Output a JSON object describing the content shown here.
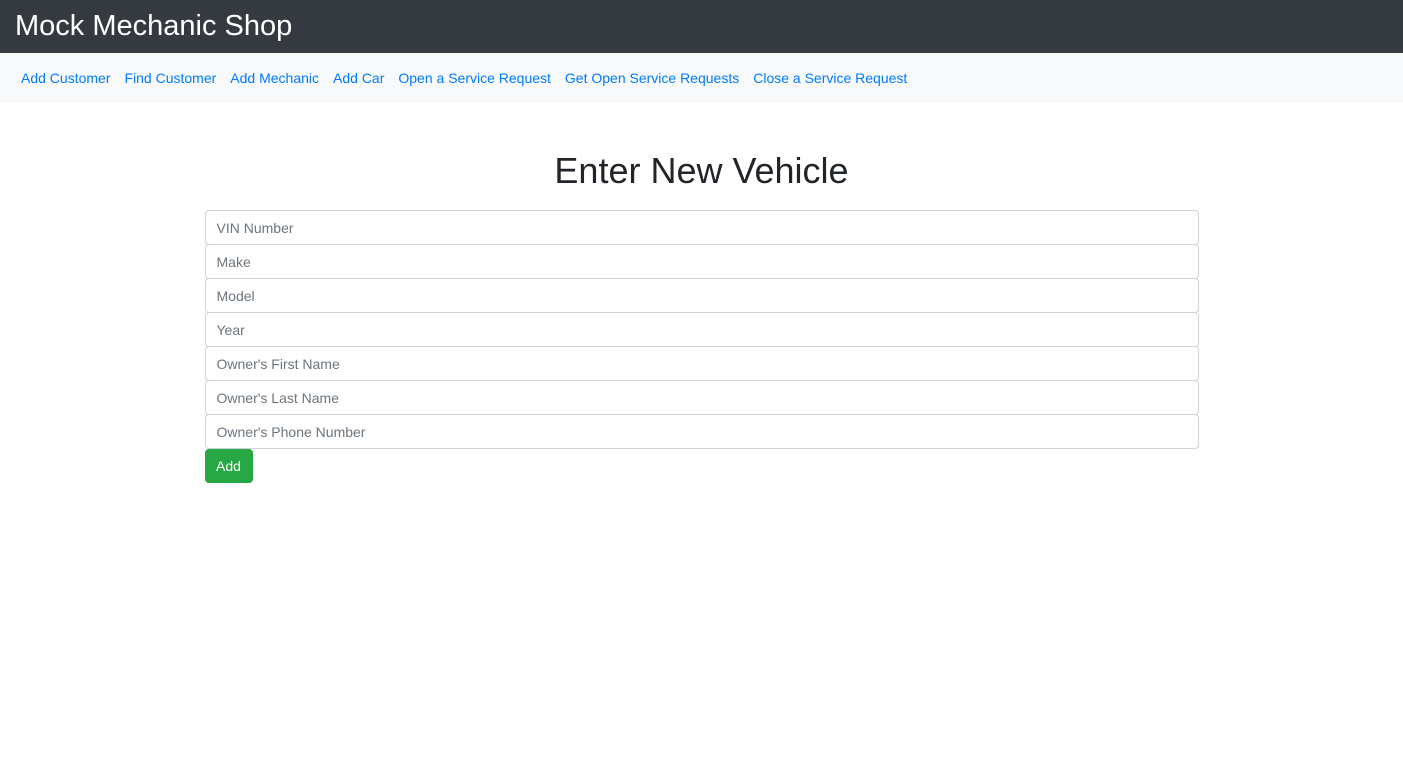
{
  "header": {
    "title": "Mock Mechanic Shop"
  },
  "nav": {
    "items": [
      {
        "label": "Add Customer"
      },
      {
        "label": "Find Customer"
      },
      {
        "label": "Add Mechanic"
      },
      {
        "label": "Add Car"
      },
      {
        "label": "Open a Service Request"
      },
      {
        "label": "Get Open Service Requests"
      },
      {
        "label": "Close a Service Request"
      }
    ]
  },
  "form": {
    "title": "Enter New Vehicle",
    "fields": {
      "vin": {
        "placeholder": "VIN Number",
        "value": ""
      },
      "make": {
        "placeholder": "Make",
        "value": ""
      },
      "model": {
        "placeholder": "Model",
        "value": ""
      },
      "year": {
        "placeholder": "Year",
        "value": ""
      },
      "first_name": {
        "placeholder": "Owner's First Name",
        "value": ""
      },
      "last_name": {
        "placeholder": "Owner's Last Name",
        "value": ""
      },
      "phone": {
        "placeholder": "Owner's Phone Number",
        "value": ""
      }
    },
    "submit_label": "Add"
  },
  "colors": {
    "header_bg": "#343a40",
    "subnav_bg": "#f8f9fa",
    "link": "#007bff",
    "submit": "#28a745"
  }
}
